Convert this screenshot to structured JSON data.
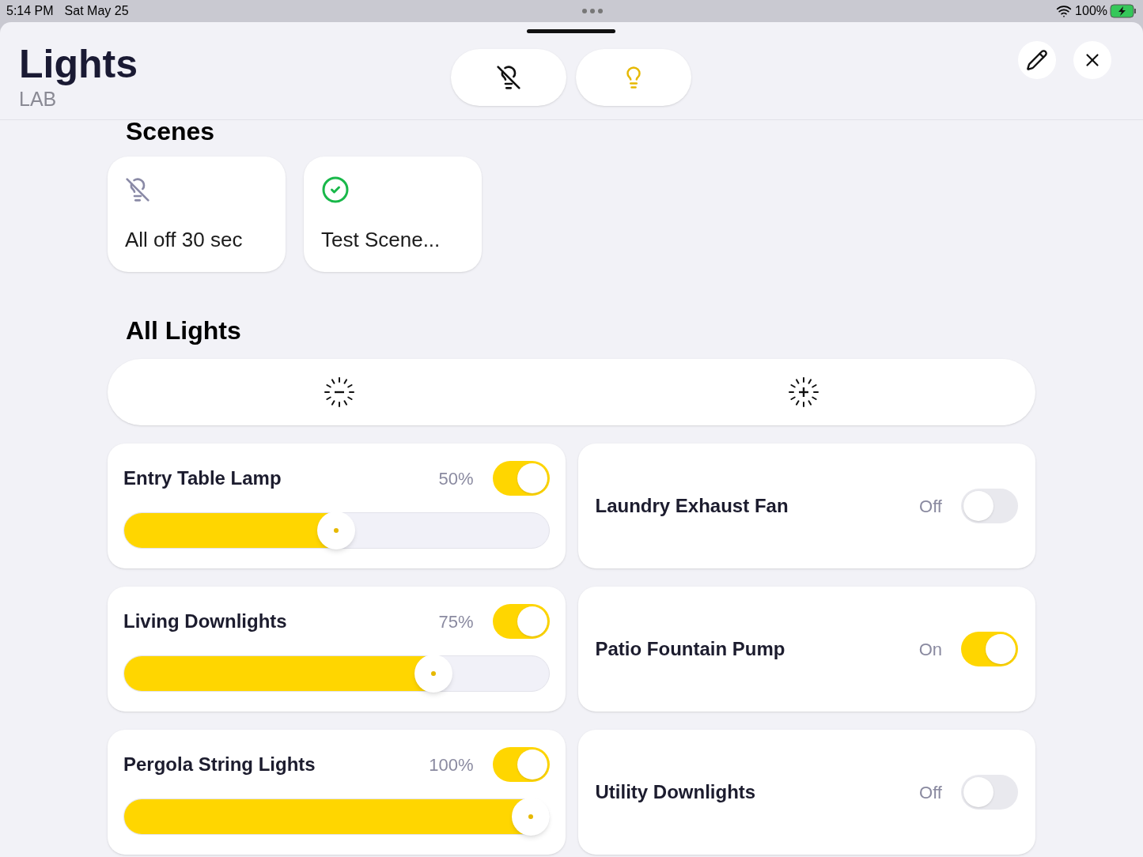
{
  "status_bar": {
    "time": "5:14 PM",
    "date": "Sat May 25",
    "battery": "100%"
  },
  "header": {
    "title": "Lights",
    "subtitle": "LAB"
  },
  "scenes": {
    "heading": "Scenes",
    "items": [
      {
        "label": "All off 30 sec",
        "kind": "off"
      },
      {
        "label": "Test Scene...",
        "kind": "active"
      }
    ]
  },
  "all_lights": {
    "heading": "All Lights"
  },
  "lights": [
    {
      "kind": "dimmer",
      "name": "Entry Table Lamp",
      "reading": "50%",
      "on": true,
      "level": 0.5
    },
    {
      "kind": "switch",
      "name": "Laundry Exhaust Fan",
      "reading": "Off",
      "on": false
    },
    {
      "kind": "dimmer",
      "name": "Living Downlights",
      "reading": "75%",
      "on": true,
      "level": 0.75
    },
    {
      "kind": "switch",
      "name": "Patio Fountain Pump",
      "reading": "On",
      "on": true
    },
    {
      "kind": "dimmer",
      "name": "Pergola String Lights",
      "reading": "100%",
      "on": true,
      "level": 1
    },
    {
      "kind": "switch",
      "name": "Utility Downlights",
      "reading": "Off",
      "on": false
    }
  ]
}
